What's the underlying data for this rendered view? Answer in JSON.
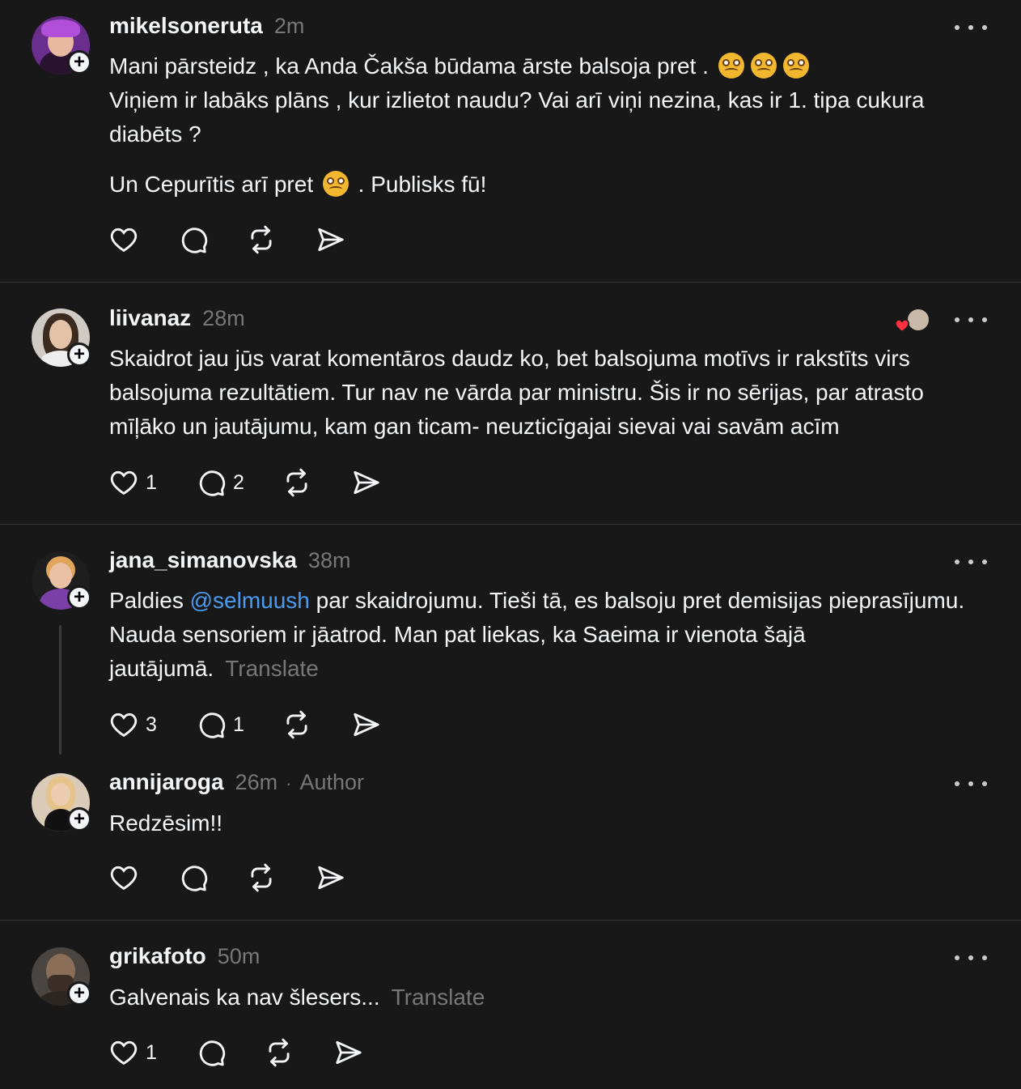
{
  "posts": [
    {
      "username": "mikelsoneruta",
      "time": "2m",
      "text_line1": "Mani pārsteidz , ka Anda Čakša būdama ārste balsoja pret .",
      "text_line2": "Viņiem ir labāks plāns , kur izlietot naudu? Vai arī viņi nezina, kas ir 1. tipa cukura diabēts ?",
      "text_line3a": "Un Cepurītis arī pret",
      "text_line3b": ". Publisks fū!",
      "likes": "",
      "replies": ""
    },
    {
      "username": "liivanaz",
      "time": "28m",
      "text": "Skaidrot jau jūs varat komentāros daudz ko, bet balsojuma motīvs ir rakstīts virs balsojuma rezultātiem. Tur nav ne vārda par ministru. Šis ir no sērijas, par atrasto mīļāko un jautājumu, kam gan ticam- neuzticīgajai sievai vai savām acīm",
      "likes": "1",
      "replies": "2"
    },
    {
      "username": "jana_simanovska",
      "time": "38m",
      "text_before": "Paldies",
      "mention": "@selmuush",
      "text_after": "par skaidrojumu. Tieši tā, es balsoju pret demisijas pieprasījumu. Nauda sensoriem ir jāatrod. Man pat liekas, ka Saeima ir vienota šajā jautājumā.",
      "translate": "Translate",
      "likes": "3",
      "replies": "1"
    },
    {
      "username": "annijaroga",
      "time": "26m",
      "separator": "·",
      "author_tag": "Author",
      "text": "Redzēsim!!",
      "likes": "",
      "replies": ""
    },
    {
      "username": "grikafoto",
      "time": "50m",
      "text": "Galvenais ka nav šlesers...",
      "translate": "Translate",
      "likes": "1",
      "replies": ""
    }
  ],
  "icons": {
    "like": "heart-icon",
    "reply": "comment-bubble-icon",
    "repost": "repost-icon",
    "share": "share-send-icon",
    "more": "more-dots-icon",
    "follow": "plus-icon",
    "emoji": "woozy-face-emoji"
  },
  "colors": {
    "background": "#181818",
    "text": "#f3f5f7",
    "muted": "#777777",
    "mention": "#4b9bf0",
    "divider": "#333638",
    "heart_red": "#ff3040"
  }
}
